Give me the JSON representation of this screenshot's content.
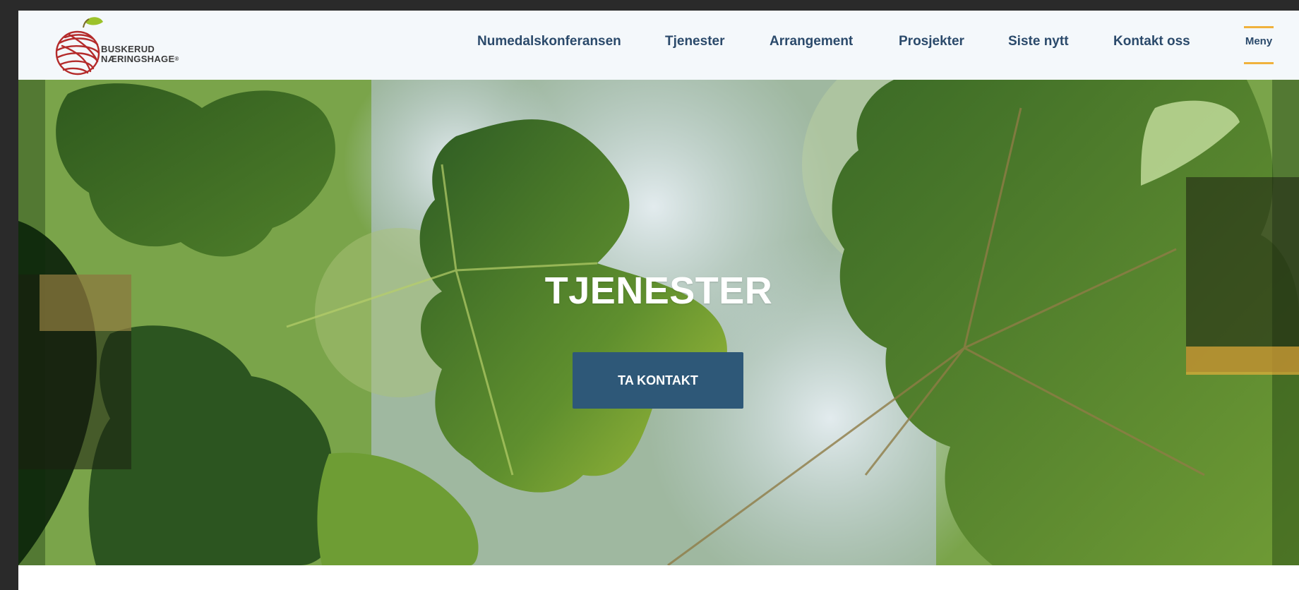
{
  "brand": {
    "line1": "BUSKERUD",
    "line2": "NÆRINGSHAGE",
    "registered_mark": "®"
  },
  "nav": {
    "items": [
      {
        "label": "Numedalskonferansen"
      },
      {
        "label": "Tjenester"
      },
      {
        "label": "Arrangement"
      },
      {
        "label": "Prosjekter"
      },
      {
        "label": "Siste nytt"
      },
      {
        "label": "Kontakt oss"
      }
    ],
    "menu_label": "Meny"
  },
  "hero": {
    "title": "TJENESTER",
    "cta_label": "TA KONTAKT"
  },
  "colors": {
    "nav_text": "#2b4a6b",
    "menu_accent": "#f0b23c",
    "cta_bg": "#2e5878",
    "header_bg": "#f4f8fb"
  }
}
